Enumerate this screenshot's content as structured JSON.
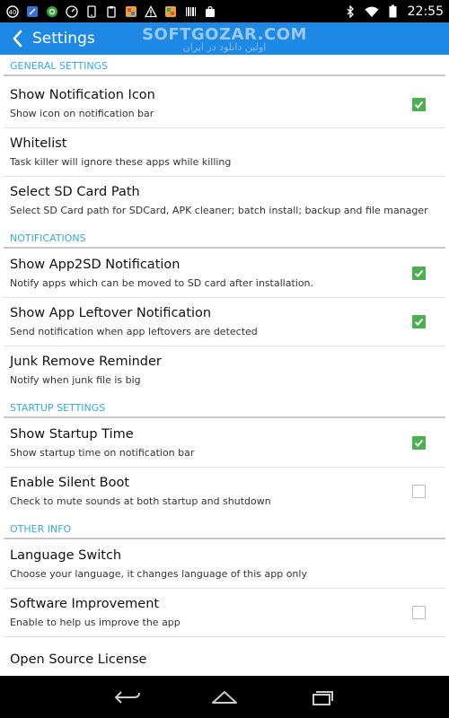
{
  "status_bar": {
    "time": "22:55",
    "left_icons": [
      "app-notification-icon",
      "bluetooth-tool-icon",
      "settings-app-icon",
      "gauge-icon",
      "phone-icon",
      "clipboard-icon",
      "gallery-icon",
      "warning-icon",
      "gallery-icon",
      "barcode-icon",
      "shopping-bag-icon"
    ],
    "right_icons": [
      "bluetooth-icon",
      "wifi-icon",
      "battery-icon"
    ]
  },
  "action_bar": {
    "title": "Settings",
    "watermark": "SOFTGOZAR.COM",
    "watermark_sub": "اولین دانلود در ایران",
    "color": "#1e88e5"
  },
  "sections": [
    {
      "header": "GENERAL SETTINGS",
      "items": [
        {
          "title": "Show Notification Icon",
          "summary": "Show icon on notification bar",
          "checkbox": "checked"
        },
        {
          "title": "Whitelist",
          "summary": "Task killer will ignore these apps while killing",
          "checkbox": "none"
        },
        {
          "title": "Select SD Card Path",
          "summary": "Select SD Card path for SDCard, APK cleaner; batch install; backup and file manager",
          "checkbox": "none"
        }
      ]
    },
    {
      "header": "NOTIFICATIONS",
      "items": [
        {
          "title": "Show App2SD Notification",
          "summary": "Notify apps which can be moved to SD card after installation.",
          "checkbox": "checked"
        },
        {
          "title": "Show App Leftover Notification",
          "summary": "Send notification when app leftovers are detected",
          "checkbox": "checked"
        },
        {
          "title": "Junk Remove Reminder",
          "summary": "Notify when junk file is big",
          "checkbox": "none"
        }
      ]
    },
    {
      "header": "STARTUP SETTINGS",
      "items": [
        {
          "title": "Show Startup Time",
          "summary": "Show startup time on notification bar",
          "checkbox": "checked"
        },
        {
          "title": "Enable Silent Boot",
          "summary": "Check to mute sounds at both startup and shutdown",
          "checkbox": "unchecked"
        }
      ]
    },
    {
      "header": "OTHER INFO",
      "items": [
        {
          "title": "Language Switch",
          "summary": "Choose your language, it changes language of this app only",
          "checkbox": "none"
        },
        {
          "title": "Software Improvement",
          "summary": "Enable to help us improve the app",
          "checkbox": "unchecked"
        },
        {
          "title": "Open Source License",
          "summary": "",
          "checkbox": "none"
        }
      ]
    }
  ],
  "colors": {
    "accent": "#33aadd",
    "check": "#4caf50"
  },
  "nav_bar": {
    "buttons": [
      "back-icon",
      "home-icon",
      "recent-apps-icon"
    ]
  }
}
